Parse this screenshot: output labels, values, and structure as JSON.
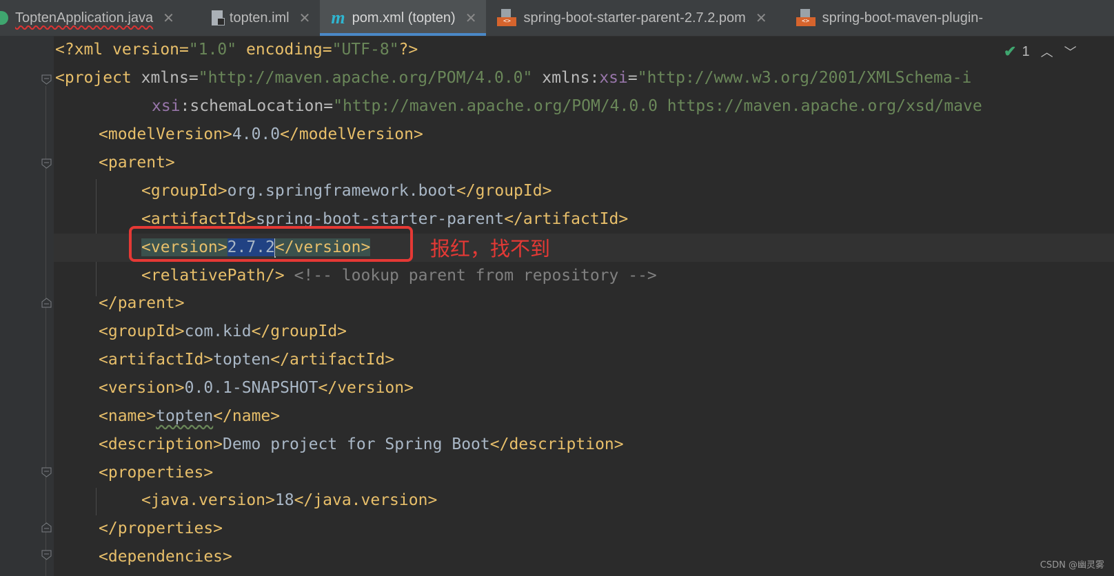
{
  "tabs": [
    {
      "label": "ToptenApplication.java",
      "icon": "java-class-icon",
      "active": false
    },
    {
      "label": "topten.iml",
      "icon": "iml-file-icon",
      "active": false
    },
    {
      "label": "pom.xml (topten)",
      "icon": "maven-icon",
      "active": true
    },
    {
      "label": "spring-boot-starter-parent-2.7.2.pom",
      "icon": "pom-file-icon",
      "active": false
    },
    {
      "label": "spring-boot-maven-plugin-",
      "icon": "pom-file-icon",
      "active": false
    }
  ],
  "close_glyph": "✕",
  "inspections": {
    "count": "1",
    "icon": "check-icon"
  },
  "code": {
    "l1": {
      "p1": "<?xml version=",
      "p2": "\"1.0\"",
      "p3": " encoding=",
      "p4": "\"UTF-8\"",
      "p5": "?>"
    },
    "l2": {
      "p1": "<project",
      "p2": " xmlns=",
      "p3": "\"http://maven.apache.org/POM/4.0.0\"",
      "p4": " xmlns:",
      "p5": "xsi",
      "p6": "=",
      "p7": "\"http://www.w3.org/2001/XMLSchema-i"
    },
    "l3": {
      "p1": "xsi",
      "p2": ":schemaLocation=",
      "p3": "\"http://maven.apache.org/POM/4.0.0 https://maven.apache.org/xsd/mave"
    },
    "l4": {
      "open": "<modelVersion>",
      "text": "4.0.0",
      "close": "</modelVersion>"
    },
    "l5": {
      "open": "<parent>"
    },
    "l6": {
      "open": "<groupId>",
      "text": "org.springframework.boot",
      "close": "</groupId>"
    },
    "l7": {
      "open": "<artifactId>",
      "text": "spring-boot-starter-parent",
      "close": "</artifactId>"
    },
    "l8": {
      "open": "<version>",
      "text": "2.7.2",
      "close": "</version>"
    },
    "l9": {
      "open": "<relativePath/>",
      "comment": " <!-- lookup parent from repository -->"
    },
    "l10": {
      "close": "</parent>"
    },
    "l11": {
      "open": "<groupId>",
      "text": "com.kid",
      "close": "</groupId>"
    },
    "l12": {
      "open": "<artifactId>",
      "text": "topten",
      "close": "</artifactId>"
    },
    "l13": {
      "open": "<version>",
      "text": "0.0.1-SNAPSHOT",
      "close": "</version>"
    },
    "l14": {
      "open": "<name>",
      "text": "topten",
      "close": "</name>"
    },
    "l15": {
      "open": "<description>",
      "text": "Demo project for Spring Boot",
      "close": "</description>"
    },
    "l16": {
      "open": "<properties>"
    },
    "l17": {
      "open": "<java.version>",
      "text": "18",
      "close": "</java.version>"
    },
    "l18": {
      "close": "</properties>"
    },
    "l19": {
      "open": "<dependencies>"
    }
  },
  "annotation": "报红，找不到",
  "annotation_color": "#e53935",
  "watermark": "CSDN @幽灵雾"
}
